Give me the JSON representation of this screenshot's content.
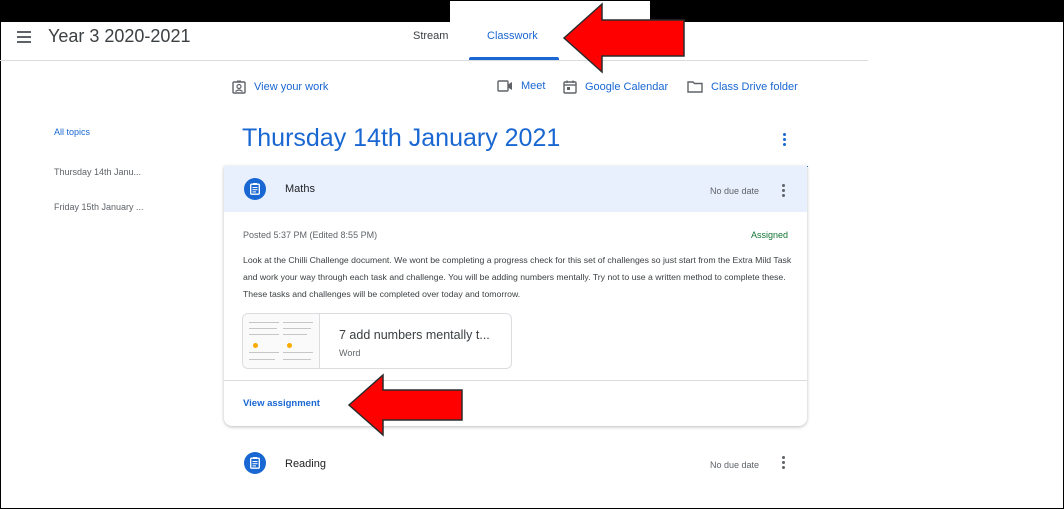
{
  "header": {
    "class_title": "Year 3 2020-2021",
    "tabs": [
      {
        "label": "Stream",
        "active": false
      },
      {
        "label": "Classwork",
        "active": true
      }
    ]
  },
  "toolbar": {
    "view_your_work": "View your work",
    "meet": "Meet",
    "google_calendar": "Google Calendar",
    "class_drive_folder": "Class Drive folder"
  },
  "sidebar": {
    "topics": [
      {
        "label": "All topics",
        "active": true
      },
      {
        "label": "Thursday 14th Janu...",
        "active": false
      },
      {
        "label": "Friday 15th January ...",
        "active": false
      }
    ]
  },
  "main": {
    "topic_title": "Thursday 14th January 2021",
    "assignments": [
      {
        "title": "Maths",
        "due": "No due date",
        "expanded": true,
        "posted": "Posted 5:37 PM (Edited 8:55 PM)",
        "status": "Assigned",
        "description": "Look at the Chilli Challenge document. We wont be completing a progress check for this set of challenges so just start from the Extra Mild Task and work your way through each task and challenge. You will be adding numbers mentally. Try not to use a written method to complete these. These tasks and challenges will be completed over today and tomorrow.",
        "attachment": {
          "title": "7 add numbers mentally t...",
          "type": "Word"
        },
        "view_label": "View assignment"
      },
      {
        "title": "Reading",
        "due": "No due date",
        "expanded": false
      }
    ]
  },
  "colors": {
    "accent": "#1967d2",
    "header_bg": "#e8f0fe",
    "assigned_status": "#137333",
    "annotation_arrow": "#ff0000"
  },
  "icons": {
    "menu": "hamburger-menu-icon",
    "view_work": "person-badge-icon",
    "meet": "video-camera-icon",
    "calendar": "calendar-icon",
    "drive": "folder-icon",
    "assignment": "assignment-clipboard-icon",
    "more": "more-vert-icon"
  }
}
